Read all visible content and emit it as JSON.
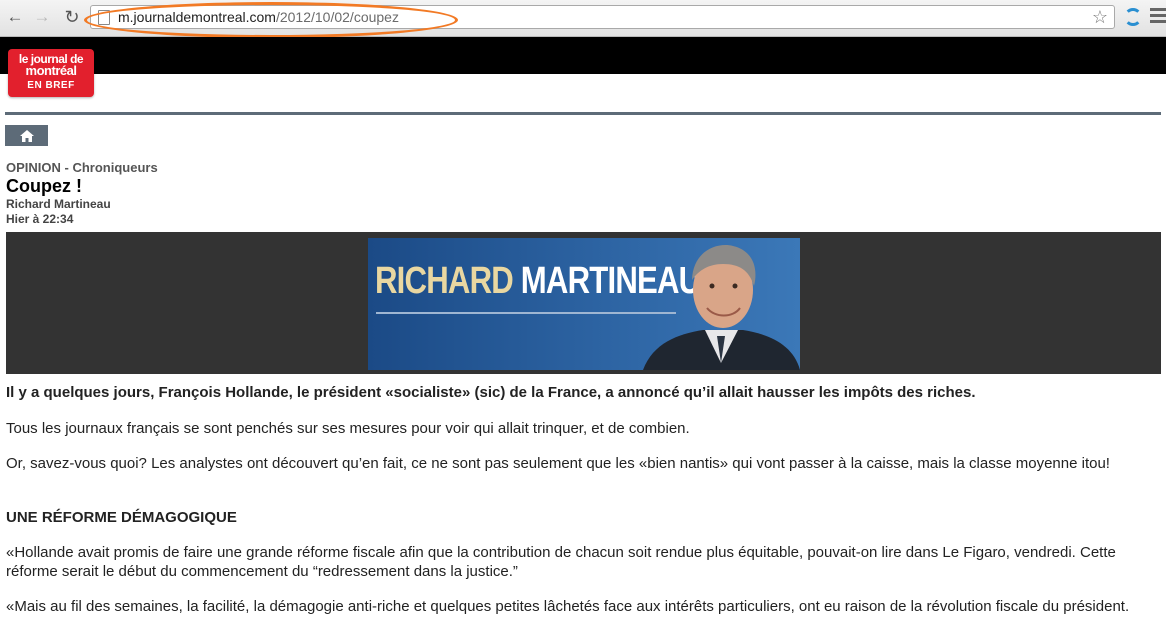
{
  "browser": {
    "url_host": "m.journaldemontreal.com",
    "url_path": "/2012/10/02/coupez"
  },
  "site": {
    "logo_line1": "le journal de",
    "logo_line2": "montréal",
    "logo_line3": "EN BREF"
  },
  "article": {
    "section": "OPINION - Chroniqueurs",
    "title": "Coupez !",
    "author": "Richard Martineau",
    "date": "Hier à 22:34",
    "banner_first": "RICHARD",
    "banner_last": "MARTINEAU",
    "paragraphs": [
      "Il y a quelques jours, François Hollande, le président «socialiste» (sic) de la France, a annoncé qu’il allait hausser les impôts des riches.",
      "Tous les journaux français se sont penchés sur ses mesures pour voir qui allait trinquer, et de combien.",
      "Or, savez-vous quoi? Les analystes ont découvert qu’en fait, ce ne sont pas seulement que les «bien nantis» qui vont passer à la caisse, mais la classe moyenne itou!",
      "UNE RÉFORME DÉMAGOGIQUE",
      "«Hollande avait promis de faire une grande réforme fiscale afin que la contribution de chacun soit rendue plus équitable, pouvait-on lire dans Le Figaro, vendredi. Cette réforme serait le début du commencement du “redressement dans la justice.”",
      "«Mais au fil des semaines, la facilité, la démagogie anti-riche et quelques petites lâchetés face aux intérêts particuliers, ont eu raison de la révolution fiscale du président."
    ]
  }
}
